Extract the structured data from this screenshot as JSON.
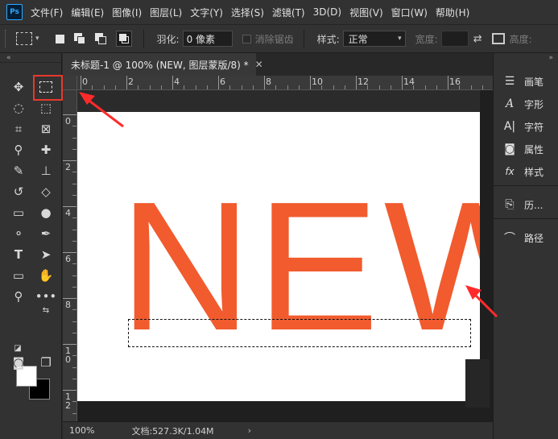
{
  "app": {
    "logo": "Ps"
  },
  "menu": [
    "文件(F)",
    "编辑(E)",
    "图像(I)",
    "图层(L)",
    "文字(Y)",
    "选择(S)",
    "滤镜(T)",
    "3D(D)",
    "视图(V)",
    "窗口(W)",
    "帮助(H)"
  ],
  "options": {
    "feather_label": "羽化:",
    "feather_value": "0 像素",
    "antialias_label": "消除锯齿",
    "style_label": "样式:",
    "style_value": "正常",
    "width_label": "宽度:",
    "height_label": "高度:"
  },
  "document": {
    "tab_title": "未标题-1 @ 100% (NEW, 图层蒙版/8) *",
    "canvas_text": "NEW",
    "text_color": "#f15b2e",
    "ruler_top": [
      "0",
      "2",
      "4",
      "6",
      "8",
      "10",
      "12",
      "14",
      "16"
    ],
    "ruler_left": [
      "0",
      "2",
      "4",
      "6",
      "8",
      "10",
      "12"
    ]
  },
  "status": {
    "zoom": "100%",
    "doc_info": "文档:527.3K/1.04M"
  },
  "tools": {
    "foreground_color": "#ffffff",
    "background_color": "#000000"
  },
  "right_panel": [
    {
      "icon": "brush-settings-icon",
      "label": "画笔"
    },
    {
      "icon": "glyphs-icon",
      "label": "字形"
    },
    {
      "icon": "character-icon",
      "label": "字符"
    },
    {
      "icon": "properties-icon",
      "label": "属性"
    },
    {
      "icon": "styles-icon",
      "label": "样式"
    },
    {
      "icon": "history-icon",
      "label": "历..."
    },
    {
      "icon": "paths-icon",
      "label": "路径"
    }
  ],
  "accent": "#e8392c"
}
